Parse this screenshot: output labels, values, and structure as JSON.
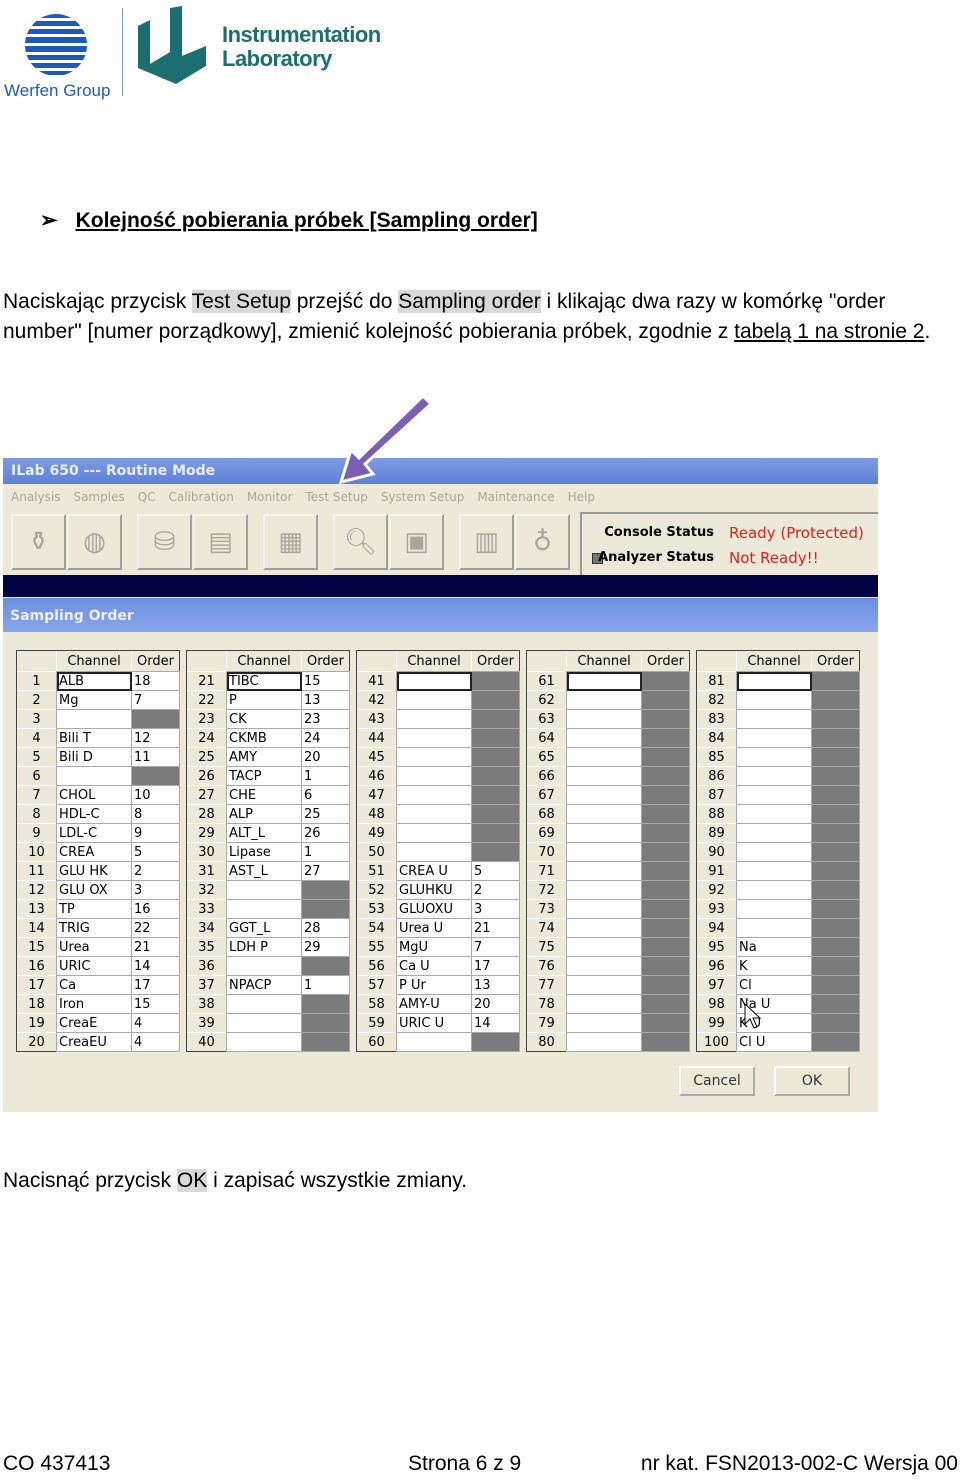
{
  "logos": {
    "werfen": "Werfen Group",
    "il_line1": "Instrumentation",
    "il_line2": "Laboratory"
  },
  "heading": {
    "bullet": "➢",
    "title": "Kolejność pobierania próbek [Sampling order]"
  },
  "paragraph1": {
    "p1": "Naciskając przycisk ",
    "h1": "Test Setup",
    "p2": " przejść do ",
    "h2": "Sampling order",
    "p3": " i klikając dwa razy w komórkę \"order number\" [numer porządkowy], zmienić kolejność pobierania próbek, zgodnie z ",
    "link": "tabelą 1 na stronie 2",
    "p4": "."
  },
  "window": {
    "title": "ILab 650 --- Routine Mode",
    "menu": [
      "Analysis",
      "Samples",
      "QC",
      "Calibration",
      "Monitor",
      "Test Setup",
      "System Setup",
      "Maintenance",
      "Help"
    ],
    "status": {
      "console_label": "Console Status",
      "console_value": "Ready (Protected)",
      "analyzer_label": "Analyzer Status",
      "analyzer_value": "Not Ready!!",
      "value_color": "#d22222"
    },
    "panel_title": "Sampling Order",
    "col_channel": "Channel",
    "col_order": "Order",
    "tables": [
      [
        [
          "1",
          "ALB",
          "18"
        ],
        [
          "2",
          "Mg",
          "7"
        ],
        [
          "3",
          "",
          null
        ],
        [
          "4",
          "Bili T",
          "12"
        ],
        [
          "5",
          "Bili D",
          "11"
        ],
        [
          "6",
          "",
          null
        ],
        [
          "7",
          "CHOL",
          "10"
        ],
        [
          "8",
          "HDL-C",
          "8"
        ],
        [
          "9",
          "LDL-C",
          "9"
        ],
        [
          "10",
          "CREA",
          "5"
        ],
        [
          "11",
          "GLU HK",
          "2"
        ],
        [
          "12",
          "GLU OX",
          "3"
        ],
        [
          "13",
          "TP",
          "16"
        ],
        [
          "14",
          "TRIG",
          "22"
        ],
        [
          "15",
          "Urea",
          "21"
        ],
        [
          "16",
          "URIC",
          "14"
        ],
        [
          "17",
          "Ca",
          "17"
        ],
        [
          "18",
          "Iron",
          "15"
        ],
        [
          "19",
          "CreaE",
          "4"
        ],
        [
          "20",
          "CreaEU",
          "4"
        ]
      ],
      [
        [
          "21",
          "TIBC",
          "15"
        ],
        [
          "22",
          "P",
          "13"
        ],
        [
          "23",
          "CK",
          "23"
        ],
        [
          "24",
          "CKMB",
          "24"
        ],
        [
          "25",
          "AMY",
          "20"
        ],
        [
          "26",
          "TACP",
          "1"
        ],
        [
          "27",
          "CHE",
          "6"
        ],
        [
          "28",
          "ALP",
          "25"
        ],
        [
          "29",
          "ALT_L",
          "26"
        ],
        [
          "30",
          "Lipase",
          "1"
        ],
        [
          "31",
          "AST_L",
          "27"
        ],
        [
          "32",
          "",
          null
        ],
        [
          "33",
          "",
          null
        ],
        [
          "34",
          "GGT_L",
          "28"
        ],
        [
          "35",
          "LDH P",
          "29"
        ],
        [
          "36",
          "",
          null
        ],
        [
          "37",
          "NPACP",
          "1"
        ],
        [
          "38",
          "",
          null
        ],
        [
          "39",
          "",
          null
        ],
        [
          "40",
          "",
          null
        ]
      ],
      [
        [
          "41",
          "",
          null
        ],
        [
          "42",
          "",
          null
        ],
        [
          "43",
          "",
          null
        ],
        [
          "44",
          "",
          null
        ],
        [
          "45",
          "",
          null
        ],
        [
          "46",
          "",
          null
        ],
        [
          "47",
          "",
          null
        ],
        [
          "48",
          "",
          null
        ],
        [
          "49",
          "",
          null
        ],
        [
          "50",
          "",
          null
        ],
        [
          "51",
          "CREA U",
          "5"
        ],
        [
          "52",
          "GLUHKU",
          "2"
        ],
        [
          "53",
          "GLUOXU",
          "3"
        ],
        [
          "54",
          "Urea U",
          "21"
        ],
        [
          "55",
          "MgU",
          "7"
        ],
        [
          "56",
          "Ca U",
          "17"
        ],
        [
          "57",
          "P Ur",
          "13"
        ],
        [
          "58",
          "AMY-U",
          "20"
        ],
        [
          "59",
          "URIC U",
          "14"
        ],
        [
          "60",
          "",
          null
        ]
      ],
      [
        [
          "61",
          "",
          null
        ],
        [
          "62",
          "",
          null
        ],
        [
          "63",
          "",
          null
        ],
        [
          "64",
          "",
          null
        ],
        [
          "65",
          "",
          null
        ],
        [
          "66",
          "",
          null
        ],
        [
          "67",
          "",
          null
        ],
        [
          "68",
          "",
          null
        ],
        [
          "69",
          "",
          null
        ],
        [
          "70",
          "",
          null
        ],
        [
          "71",
          "",
          null
        ],
        [
          "72",
          "",
          null
        ],
        [
          "73",
          "",
          null
        ],
        [
          "74",
          "",
          null
        ],
        [
          "75",
          "",
          null
        ],
        [
          "76",
          "",
          null
        ],
        [
          "77",
          "",
          null
        ],
        [
          "78",
          "",
          null
        ],
        [
          "79",
          "",
          null
        ],
        [
          "80",
          "",
          null
        ]
      ],
      [
        [
          "81",
          "",
          null
        ],
        [
          "82",
          "",
          null
        ],
        [
          "83",
          "",
          null
        ],
        [
          "84",
          "",
          null
        ],
        [
          "85",
          "",
          null
        ],
        [
          "86",
          "",
          null
        ],
        [
          "87",
          "",
          null
        ],
        [
          "88",
          "",
          null
        ],
        [
          "89",
          "",
          null
        ],
        [
          "90",
          "",
          null
        ],
        [
          "91",
          "",
          null
        ],
        [
          "92",
          "",
          null
        ],
        [
          "93",
          "",
          null
        ],
        [
          "94",
          "",
          null
        ],
        [
          "95",
          "Na",
          null
        ],
        [
          "96",
          "K",
          null
        ],
        [
          "97",
          "Cl",
          null
        ],
        [
          "98",
          "Na U",
          null
        ],
        [
          "99",
          "K U",
          null
        ],
        [
          "100",
          "Cl U",
          null
        ]
      ]
    ],
    "cancel_label": "Cancel",
    "ok_label": "OK"
  },
  "paragraph2": {
    "p1": "Nacisnąć przycisk ",
    "h1": "OK",
    "p2": " i zapisać wszystkie zmiany."
  },
  "footer": {
    "left": "CO 437413",
    "center": "Strona 6 z 9",
    "right": "nr kat. FSN2013-002-C Wersja 00"
  },
  "colors": {
    "arrow": "#7b5fb5",
    "il_brand": "#1d6e70",
    "werfen_blue": "#1e5bb8"
  }
}
